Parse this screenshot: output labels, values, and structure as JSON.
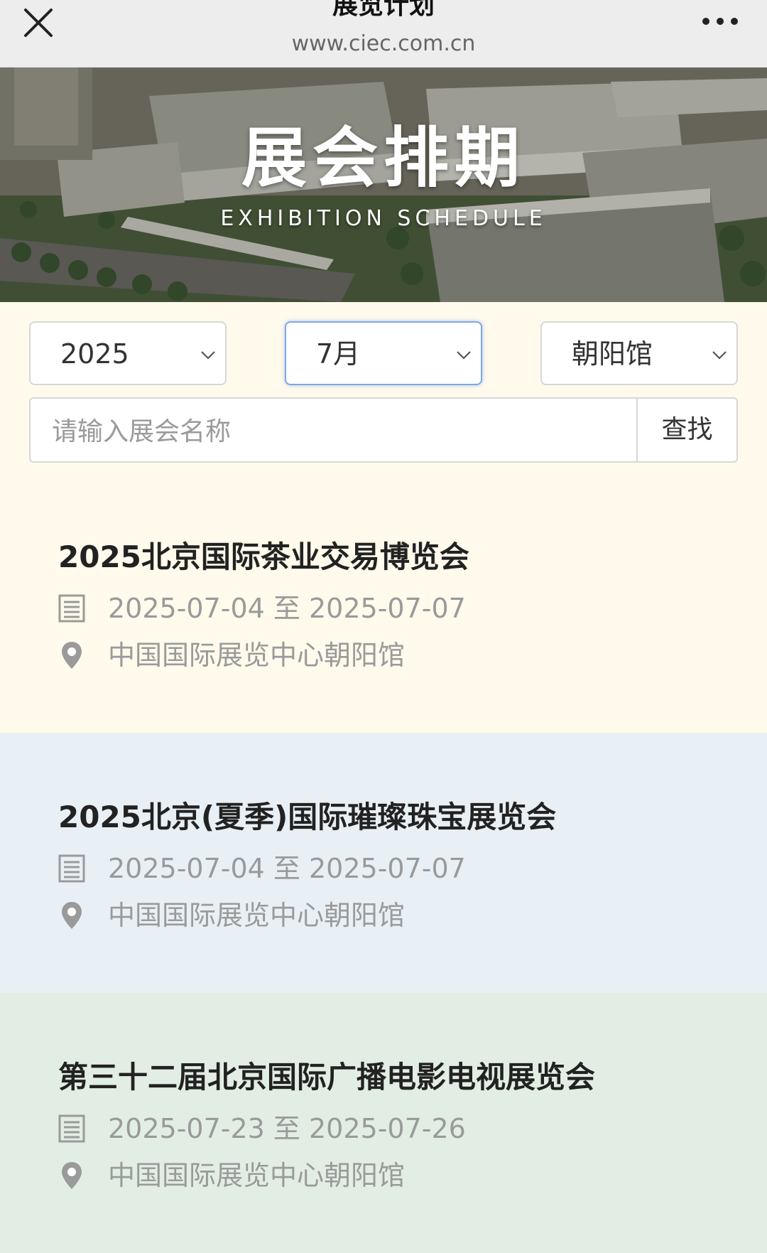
{
  "header": {
    "title": "展览计划",
    "url": "www.ciec.com.cn"
  },
  "banner": {
    "title": "展会排期",
    "subtitle": "EXHIBITION SCHEDULE"
  },
  "filters": {
    "year": "2025",
    "month": "7月",
    "venue": "朝阳馆",
    "search_placeholder": "请输入展会名称",
    "search_button": "查找"
  },
  "events": [
    {
      "title": "2025北京国际茶业交易博览会",
      "dates": "2025-07-04 至  2025-07-07",
      "location": "中国国际展览中心朝阳馆",
      "bg": "#fffaec"
    },
    {
      "title": "2025北京(夏季)国际璀璨珠宝展览会",
      "dates": "2025-07-04 至  2025-07-07",
      "location": "中国国际展览中心朝阳馆",
      "bg": "#e9f0f5"
    },
    {
      "title": "第三十二届北京国际广播电影电视展览会",
      "dates": "2025-07-23 至  2025-07-26",
      "location": "中国国际展览中心朝阳馆",
      "bg": "#e2eee4"
    }
  ]
}
